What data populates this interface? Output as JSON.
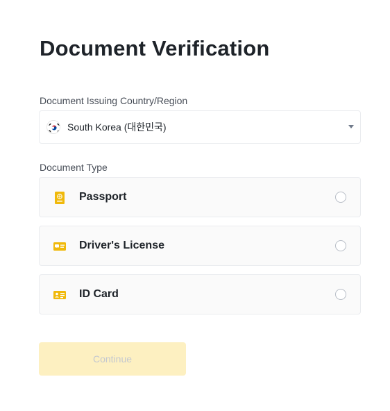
{
  "page": {
    "title": "Document Verification"
  },
  "country": {
    "label": "Document Issuing Country/Region",
    "selected": "South Korea (대한민국)",
    "flag_icon": "south-korea-flag-icon"
  },
  "document_type": {
    "label": "Document Type",
    "options": [
      {
        "label": "Passport",
        "icon": "passport-icon",
        "selected": false
      },
      {
        "label": "Driver's License",
        "icon": "drivers-license-icon",
        "selected": false
      },
      {
        "label": "ID Card",
        "icon": "id-card-icon",
        "selected": false
      }
    ]
  },
  "actions": {
    "continue_label": "Continue",
    "continue_enabled": false
  },
  "colors": {
    "accent_yellow": "#F0B90B",
    "button_disabled_bg": "#FDF0C1",
    "button_disabled_text": "#C4C8CF",
    "text_primary": "#1E2329",
    "text_secondary": "#474D57",
    "border": "#EAECEF"
  }
}
